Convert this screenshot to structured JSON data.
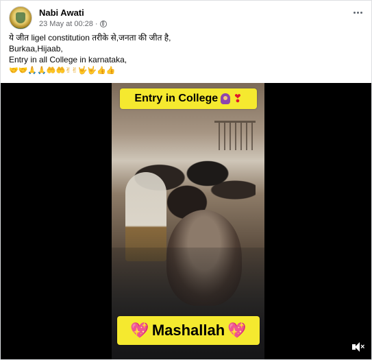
{
  "post": {
    "author": "Nabi Awati",
    "timestamp": "23 May at 00:28",
    "separator": "·",
    "lines": [
      "ये जीत ligel constitution तरीके से,जनता की जीत है,",
      "Burkaa,Hijaab,",
      "Entry in all College in karnataka,"
    ],
    "emoji_line": "🤝🤝🙏🙏🤲🤲✌✌🤟🤟👍👍"
  },
  "video": {
    "top_banner": "Entry in College",
    "bottom_banner": "Mashallah",
    "heart": "❣",
    "sparkle_heart": "💖"
  },
  "icons": {
    "privacy": "globe-icon",
    "more": "more-options-icon",
    "volume": "mute-icon"
  },
  "colors": {
    "banner": "#f5e92f",
    "heart": "#e0162b"
  }
}
